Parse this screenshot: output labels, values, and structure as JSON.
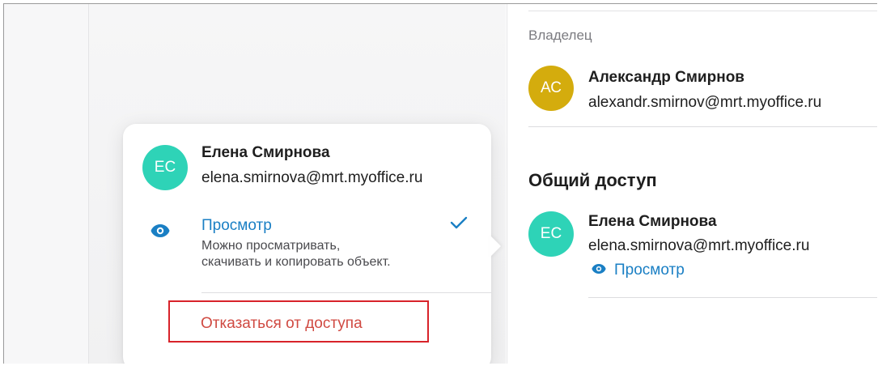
{
  "owner_section": {
    "label": "Владелец",
    "avatar": {
      "initials": "АС",
      "color": "#d4ac0d"
    },
    "name": "Александр Смирнов",
    "email": "alexandr.smirnov@mrt.myoffice.ru"
  },
  "shared_section": {
    "title": "Общий доступ",
    "user": {
      "avatar": {
        "initials": "ЕС",
        "color": "#2ed3b7"
      },
      "name": "Елена Смирнова",
      "email": "elena.smirnova@mrt.myoffice.ru",
      "permission": "Просмотр",
      "permission_icon": "eye-icon"
    }
  },
  "popover": {
    "user": {
      "avatar": {
        "initials": "ЕС",
        "color": "#2ed3b7"
      },
      "name": "Елена Смирнова",
      "email": "elena.smirnova@mrt.myoffice.ru"
    },
    "option": {
      "icon": "eye-icon",
      "title": "Просмотр",
      "description_line1": "Можно просматривать,",
      "description_line2": "скачивать и копировать объект.",
      "selected": true
    },
    "revoke_label": "Отказаться от доступа"
  },
  "colors": {
    "accent": "#1a7fc4",
    "danger": "#d04a42",
    "highlight": "#d8232a"
  }
}
